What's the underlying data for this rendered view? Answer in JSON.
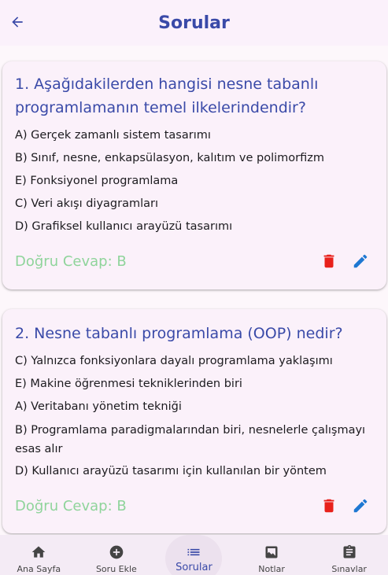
{
  "app_bar": {
    "title": "Sorular"
  },
  "questions": [
    {
      "title": "1. Aşağıdakilerden hangisi nesne tabanlı programlamanın temel ilkelerindendir?",
      "options": [
        "A) Gerçek zamanlı sistem tasarımı",
        "B) Sınıf, nesne, enkapsülasyon, kalıtım ve polimorfizm",
        "E) Fonksiyonel programlama",
        "C) Veri akışı diyagramları",
        "D) Grafiksel kullanıcı arayüzü tasarımı"
      ],
      "answer": "Doğru Cevap: B"
    },
    {
      "title": "2. Nesne tabanlı programlama (OOP) nedir?",
      "options": [
        "C) Yalnızca fonksiyonlara dayalı programlama yaklaşımı",
        "E) Makine öğrenmesi tekniklerinden biri",
        "A) Veritabanı yönetim tekniği",
        "B) Programlama paradigmalarından biri, nesnelerle çalışmayı esas alır",
        "D) Kullanıcı arayüzü tasarımı için kullanılan bir yöntem"
      ],
      "answer": "Doğru Cevap: B"
    }
  ],
  "nav": [
    {
      "label": "Ana Sayfa",
      "icon": "home-icon"
    },
    {
      "label": "Soru Ekle",
      "icon": "add-circle-icon"
    },
    {
      "label": "Sorular",
      "icon": "list-icon"
    },
    {
      "label": "Notlar",
      "icon": "notes-icon"
    },
    {
      "label": "Sınavlar",
      "icon": "assignment-icon"
    }
  ],
  "colors": {
    "primary": "#3a4aa8",
    "answer": "#8fd49b",
    "delete": "#e8211b",
    "edit": "#1e78d2"
  }
}
